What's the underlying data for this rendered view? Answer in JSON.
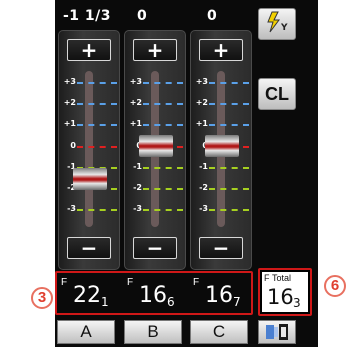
{
  "columns": [
    {
      "ev": "-1 1/3",
      "knob_ev": -1.33
    },
    {
      "ev": "0",
      "knob_ev": 0
    },
    {
      "ev": "0",
      "knob_ev": 0
    }
  ],
  "scale": [
    "+3",
    "+2",
    "+1",
    "0",
    "-1",
    "-2",
    "-3"
  ],
  "buttons": {
    "plus": "+",
    "minus": "−"
  },
  "side": {
    "cl_label": "CL"
  },
  "fvalues": [
    {
      "prefix": "F",
      "main": "22",
      "sub": "1"
    },
    {
      "prefix": "F",
      "main": "16",
      "sub": "6"
    },
    {
      "prefix": "F",
      "main": "16",
      "sub": "7"
    }
  ],
  "ftotal": {
    "prefix": "F",
    "label": "Total",
    "main": "16",
    "sub": "3"
  },
  "channels": [
    "A",
    "B",
    "C"
  ],
  "callouts": {
    "left": "3",
    "right": "6"
  },
  "icons": {
    "flash": "flash-mode-icon",
    "display": "display-toggle-icon"
  },
  "colors": {
    "positive": "#5aa0e8",
    "zero": "#e02020",
    "negative": "#a6d020",
    "callout": "#e04030"
  }
}
